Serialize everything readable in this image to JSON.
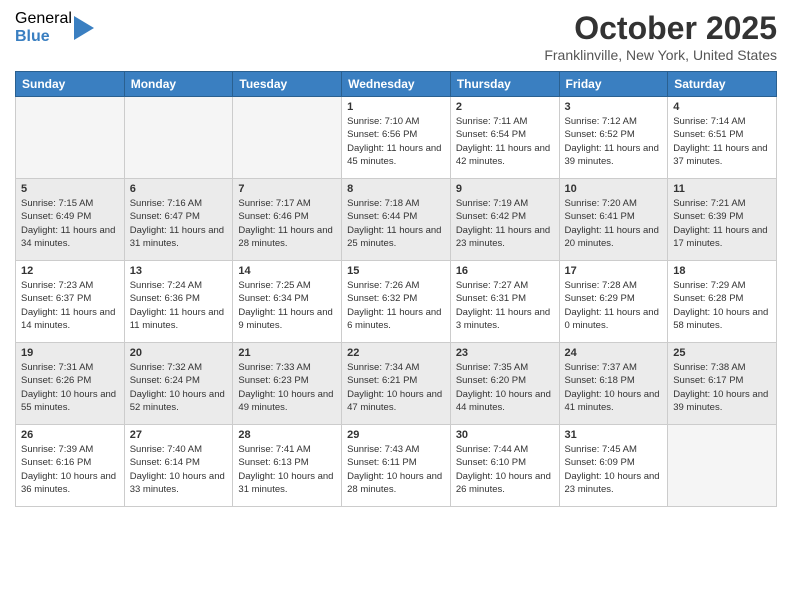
{
  "logo": {
    "general": "General",
    "blue": "Blue"
  },
  "header": {
    "month": "October 2025",
    "location": "Franklinville, New York, United States"
  },
  "days_of_week": [
    "Sunday",
    "Monday",
    "Tuesday",
    "Wednesday",
    "Thursday",
    "Friday",
    "Saturday"
  ],
  "weeks": [
    [
      {
        "day": "",
        "info": ""
      },
      {
        "day": "",
        "info": ""
      },
      {
        "day": "",
        "info": ""
      },
      {
        "day": "1",
        "info": "Sunrise: 7:10 AM\nSunset: 6:56 PM\nDaylight: 11 hours and 45 minutes."
      },
      {
        "day": "2",
        "info": "Sunrise: 7:11 AM\nSunset: 6:54 PM\nDaylight: 11 hours and 42 minutes."
      },
      {
        "day": "3",
        "info": "Sunrise: 7:12 AM\nSunset: 6:52 PM\nDaylight: 11 hours and 39 minutes."
      },
      {
        "day": "4",
        "info": "Sunrise: 7:14 AM\nSunset: 6:51 PM\nDaylight: 11 hours and 37 minutes."
      }
    ],
    [
      {
        "day": "5",
        "info": "Sunrise: 7:15 AM\nSunset: 6:49 PM\nDaylight: 11 hours and 34 minutes."
      },
      {
        "day": "6",
        "info": "Sunrise: 7:16 AM\nSunset: 6:47 PM\nDaylight: 11 hours and 31 minutes."
      },
      {
        "day": "7",
        "info": "Sunrise: 7:17 AM\nSunset: 6:46 PM\nDaylight: 11 hours and 28 minutes."
      },
      {
        "day": "8",
        "info": "Sunrise: 7:18 AM\nSunset: 6:44 PM\nDaylight: 11 hours and 25 minutes."
      },
      {
        "day": "9",
        "info": "Sunrise: 7:19 AM\nSunset: 6:42 PM\nDaylight: 11 hours and 23 minutes."
      },
      {
        "day": "10",
        "info": "Sunrise: 7:20 AM\nSunset: 6:41 PM\nDaylight: 11 hours and 20 minutes."
      },
      {
        "day": "11",
        "info": "Sunrise: 7:21 AM\nSunset: 6:39 PM\nDaylight: 11 hours and 17 minutes."
      }
    ],
    [
      {
        "day": "12",
        "info": "Sunrise: 7:23 AM\nSunset: 6:37 PM\nDaylight: 11 hours and 14 minutes."
      },
      {
        "day": "13",
        "info": "Sunrise: 7:24 AM\nSunset: 6:36 PM\nDaylight: 11 hours and 11 minutes."
      },
      {
        "day": "14",
        "info": "Sunrise: 7:25 AM\nSunset: 6:34 PM\nDaylight: 11 hours and 9 minutes."
      },
      {
        "day": "15",
        "info": "Sunrise: 7:26 AM\nSunset: 6:32 PM\nDaylight: 11 hours and 6 minutes."
      },
      {
        "day": "16",
        "info": "Sunrise: 7:27 AM\nSunset: 6:31 PM\nDaylight: 11 hours and 3 minutes."
      },
      {
        "day": "17",
        "info": "Sunrise: 7:28 AM\nSunset: 6:29 PM\nDaylight: 11 hours and 0 minutes."
      },
      {
        "day": "18",
        "info": "Sunrise: 7:29 AM\nSunset: 6:28 PM\nDaylight: 10 hours and 58 minutes."
      }
    ],
    [
      {
        "day": "19",
        "info": "Sunrise: 7:31 AM\nSunset: 6:26 PM\nDaylight: 10 hours and 55 minutes."
      },
      {
        "day": "20",
        "info": "Sunrise: 7:32 AM\nSunset: 6:24 PM\nDaylight: 10 hours and 52 minutes."
      },
      {
        "day": "21",
        "info": "Sunrise: 7:33 AM\nSunset: 6:23 PM\nDaylight: 10 hours and 49 minutes."
      },
      {
        "day": "22",
        "info": "Sunrise: 7:34 AM\nSunset: 6:21 PM\nDaylight: 10 hours and 47 minutes."
      },
      {
        "day": "23",
        "info": "Sunrise: 7:35 AM\nSunset: 6:20 PM\nDaylight: 10 hours and 44 minutes."
      },
      {
        "day": "24",
        "info": "Sunrise: 7:37 AM\nSunset: 6:18 PM\nDaylight: 10 hours and 41 minutes."
      },
      {
        "day": "25",
        "info": "Sunrise: 7:38 AM\nSunset: 6:17 PM\nDaylight: 10 hours and 39 minutes."
      }
    ],
    [
      {
        "day": "26",
        "info": "Sunrise: 7:39 AM\nSunset: 6:16 PM\nDaylight: 10 hours and 36 minutes."
      },
      {
        "day": "27",
        "info": "Sunrise: 7:40 AM\nSunset: 6:14 PM\nDaylight: 10 hours and 33 minutes."
      },
      {
        "day": "28",
        "info": "Sunrise: 7:41 AM\nSunset: 6:13 PM\nDaylight: 10 hours and 31 minutes."
      },
      {
        "day": "29",
        "info": "Sunrise: 7:43 AM\nSunset: 6:11 PM\nDaylight: 10 hours and 28 minutes."
      },
      {
        "day": "30",
        "info": "Sunrise: 7:44 AM\nSunset: 6:10 PM\nDaylight: 10 hours and 26 minutes."
      },
      {
        "day": "31",
        "info": "Sunrise: 7:45 AM\nSunset: 6:09 PM\nDaylight: 10 hours and 23 minutes."
      },
      {
        "day": "",
        "info": ""
      }
    ]
  ],
  "row_shading": [
    false,
    true,
    false,
    true,
    false
  ]
}
